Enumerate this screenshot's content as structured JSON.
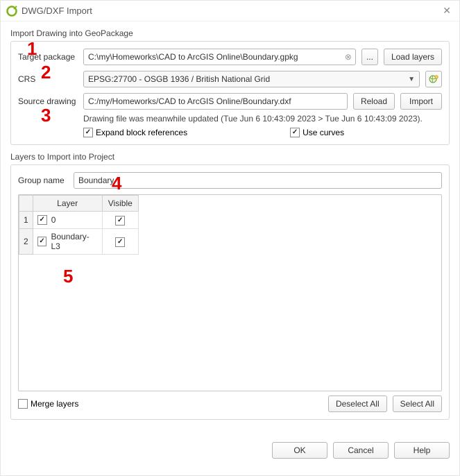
{
  "window": {
    "title": "DWG/DXF Import"
  },
  "sections": {
    "import_title": "Import Drawing into GeoPackage",
    "layers_title": "Layers to Import into Project"
  },
  "fields": {
    "target_package_label": "Target package",
    "target_package_value": "C:\\my\\Homeworks\\CAD to ArcGIS Online\\Boundary.gpkg",
    "crs_label": "CRS",
    "crs_value": "EPSG:27700 - OSGB 1936 / British National Grid",
    "source_label": "Source drawing",
    "source_value": "C:/my/Homeworks/CAD to ArcGIS Online/Boundary.dxf",
    "status_text": "Drawing file was meanwhile updated (Tue Jun 6 10:43:09 2023 > Tue Jun 6 10:43:09 2023).",
    "expand_label": "Expand block references",
    "curves_label": "Use curves",
    "group_name_label": "Group name",
    "group_name_value": "Boundary",
    "merge_label": "Merge layers"
  },
  "buttons": {
    "browse": "...",
    "load_layers": "Load layers",
    "reload": "Reload",
    "import": "Import",
    "deselect_all": "Deselect All",
    "select_all": "Select All",
    "ok": "OK",
    "cancel": "Cancel",
    "help": "Help"
  },
  "table": {
    "header_layer": "Layer",
    "header_visible": "Visible",
    "rows": [
      {
        "n": "1",
        "name": "0",
        "checked": true,
        "visible": true
      },
      {
        "n": "2",
        "name": "Boundary-L3",
        "checked": true,
        "visible": true
      }
    ]
  },
  "annotations": {
    "a1": "1",
    "a2": "2",
    "a3": "3",
    "a4": "4",
    "a5": "5"
  }
}
